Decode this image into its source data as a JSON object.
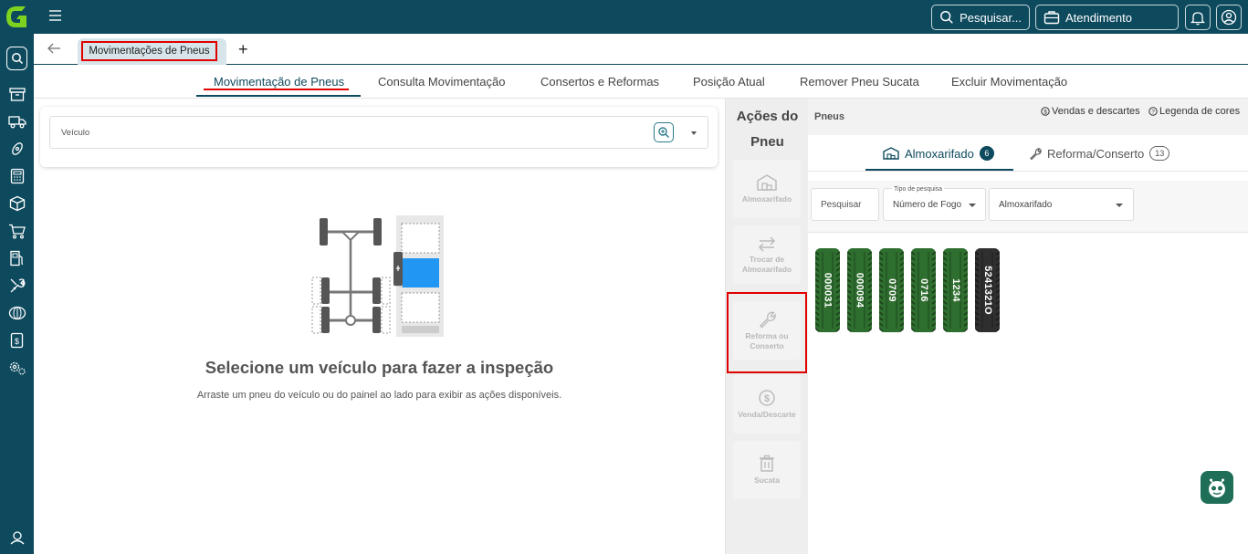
{
  "topbar": {
    "search_label": "Pesquisar...",
    "support_label": "Atendimento"
  },
  "tabs": {
    "active_label": "Movimentações de Pneus",
    "add_label": "+"
  },
  "subnav": {
    "items": [
      {
        "label": "Movimentação de Pneus",
        "active": true
      },
      {
        "label": "Consulta Movimentação"
      },
      {
        "label": "Consertos e Reformas"
      },
      {
        "label": "Posição Atual"
      },
      {
        "label": "Remover Pneu Sucata"
      },
      {
        "label": "Excluir Movimentação"
      }
    ]
  },
  "vehicle": {
    "label": "Veículo"
  },
  "empty_state": {
    "title": "Selecione um veículo para fazer a inspeção",
    "subtitle": "Arraste um pneu do veículo ou do painel ao lado para exibir as ações disponíveis."
  },
  "actions": {
    "title_line1": "Ações do",
    "title_line2": "Pneu",
    "buttons": [
      {
        "label": "Almoxarifado",
        "icon": "warehouse-icon"
      },
      {
        "label": "Trocar de Almoxarifado",
        "icon": "swap-arrows-icon"
      },
      {
        "label": "Reforma ou Conserto",
        "icon": "wrench-icon"
      },
      {
        "label": "Venda/Descarte",
        "icon": "dollar-circle-icon"
      },
      {
        "label": "Sucata",
        "icon": "trash-icon"
      }
    ]
  },
  "tyres_panel": {
    "title": "Pneus",
    "sales_link": "Vendas e descartes",
    "legend_link": "Legenda de cores",
    "tabs": [
      {
        "label": "Almoxarifado",
        "count": "6",
        "active": true
      },
      {
        "label": "Reforma/Conserto",
        "count": "13"
      }
    ],
    "filters": {
      "search_placeholder": "Pesquisar",
      "search_type_label": "Tipo de pesquisa",
      "search_type_value": "Número de Fogo",
      "warehouse_value": "Almoxarifado"
    },
    "tyres": [
      {
        "number": "000031",
        "color": "#2e6e2e"
      },
      {
        "number": "000094",
        "color": "#2e6e2e"
      },
      {
        "number": "0709",
        "color": "#2e6e2e"
      },
      {
        "number": "0716",
        "color": "#2e6e2e"
      },
      {
        "number": "1234",
        "color": "#2e6e2e"
      },
      {
        "number": "5241321O",
        "color": "#2f2f2f"
      }
    ]
  },
  "colors": {
    "brand_dark": "#0e4a5e",
    "highlight_red": "#e00000",
    "tyre_green": "#2e6e2e"
  }
}
